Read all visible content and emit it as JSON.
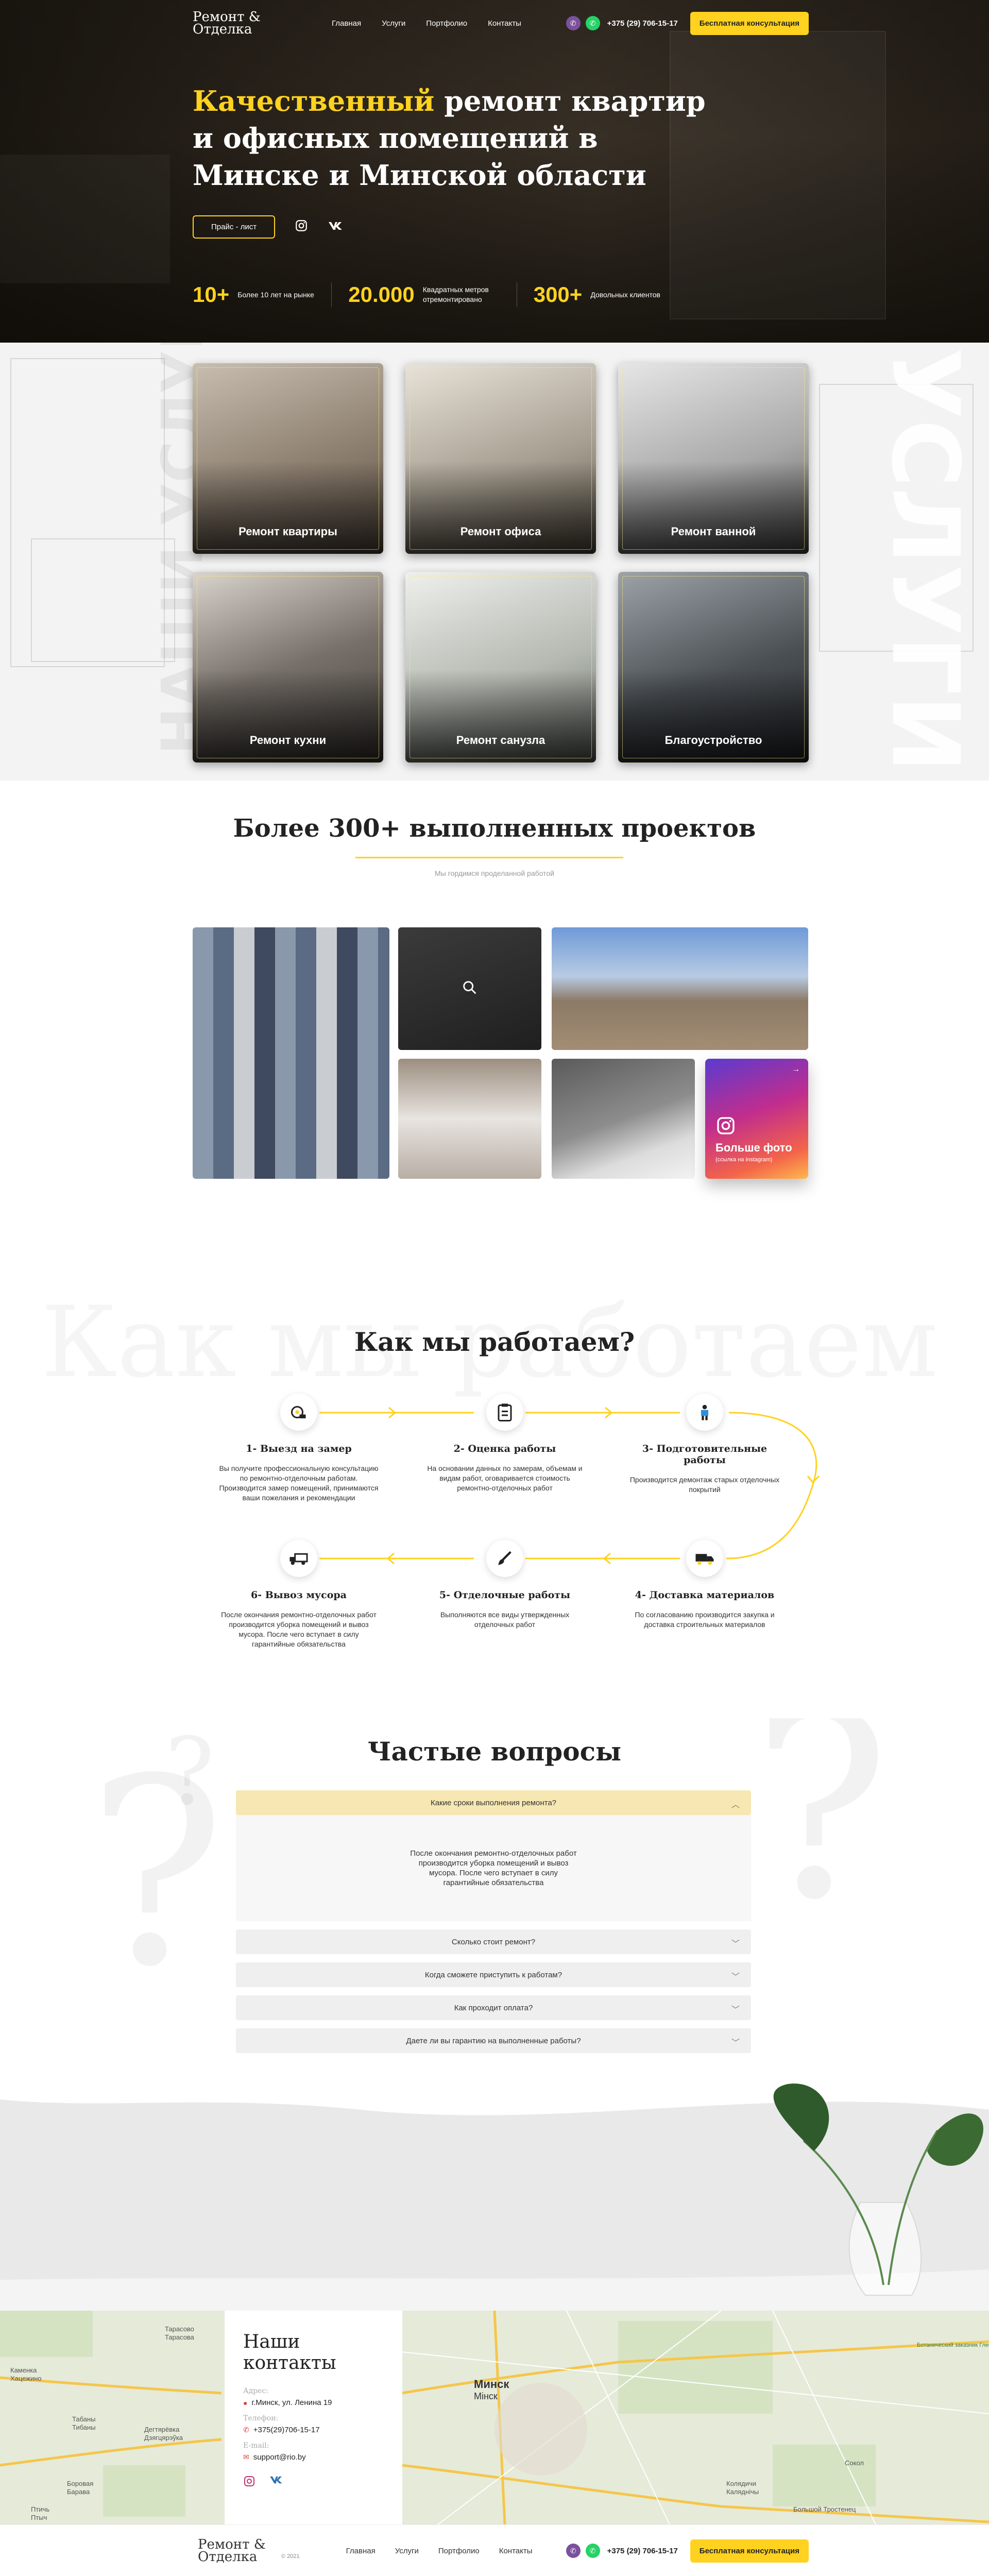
{
  "header": {
    "logo": "Ремонт & Отделка",
    "nav": [
      "Главная",
      "Услуги",
      "Портфолио",
      "Контакты"
    ],
    "phone": "+375 (29) 706-15-17",
    "cta": "Бесплатная консультация"
  },
  "hero": {
    "title_highlight": "Качественный",
    "title_rest": " ремонт квартир и офисных помещений в Минске и Минской области",
    "price_button": "Прайс - лист",
    "stats": [
      {
        "value": "10+",
        "text": "Более 10 лет на рынке"
      },
      {
        "value": "20.000",
        "text": "Квадратных метров отремонтировано"
      },
      {
        "value": "300+",
        "text": "Довольных клиентов"
      }
    ]
  },
  "services": {
    "side_text": "НАШИ УСЛУГИ",
    "side_text_right": "УСЛУГИ",
    "cards": [
      "Ремонт квартиры",
      "Ремонт офиса",
      "Ремонт ванной",
      "Ремонт кухни",
      "Ремонт санузла",
      "Благоустройство"
    ]
  },
  "projects": {
    "title": "Более 300+  выполненных проектов",
    "subtitle": "Мы гордимся проделанной работой",
    "more_photo": "Больше фото",
    "more_photo_sub": "(ссылка на instagram)"
  },
  "how": {
    "bg_text": "Как мы работаем",
    "title": "Как мы работаем?",
    "steps": [
      {
        "title": "1- Выезд на замер",
        "text": "Вы получите профессиональную консультацию по ремонтно-отделочным работам. Производится замер помещений, принимаются ваши пожелания и рекомендации"
      },
      {
        "title": "2- Оценка работы",
        "text": "На основании данных по замерам, объемам и видам работ, оговаривается стоимость ремонтно-отделочных работ"
      },
      {
        "title": "3- Подготовительные работы",
        "text": "Производится демонтаж старых отделочных покрытий"
      },
      {
        "title": "4- Доставка материалов",
        "text": "По согласованию производится закупка и доставка строительных материалов"
      },
      {
        "title": "5- Отделочные работы",
        "text": "Выполняются все виды утвержденных отделочных работ"
      },
      {
        "title": "6- Вывоз мусора",
        "text": "После окончания ремонтно-отделочных работ производится уборка помещений и вывоз мусора. После чего вступает в силу гарантийные обязательства"
      }
    ]
  },
  "faq": {
    "title": "Частые вопросы",
    "items": [
      {
        "q": "Какие сроки выполнения ремонта?",
        "a": "После окончания  ремонтно-отделочных работ производится уборка помещений и вывоз мусора. После чего вступает в силу гарантийные обязательства"
      },
      {
        "q": "Сколько стоит ремонт?"
      },
      {
        "q": "Когда сможете приступить к работам?"
      },
      {
        "q": "Как проходит оплата?"
      },
      {
        "q": "Даете ли вы гарантию на выполненные работы?"
      }
    ]
  },
  "contacts": {
    "title": "Наши контакты",
    "address_label": "Адрес:",
    "address": "г.Минск, ул. Ленина 19",
    "phone_label": "Телефон:",
    "phone": "+375(29)706-15-17",
    "email_label": "E-mail:",
    "email": "support@rio.by",
    "map_labels": [
      "Тарасово",
      "Тарасова",
      "Каменка",
      "Хацежино",
      "Табаны",
      "Тибаны",
      "Дегтярёвка",
      "Дзягцярэўка",
      "Боровая",
      "Барава",
      "Минск",
      "Мінск",
      "Ботанический заказник Глебовка",
      "Сокол",
      "Колядичи",
      "Каляднічы",
      "Большой Тростенец",
      "Птичь",
      "Птыч"
    ]
  },
  "footer": {
    "logo": "Ремонт & Отделка",
    "copyright": "© 2021",
    "nav": [
      "Главная",
      "Услуги",
      "Портфолио",
      "Контакты"
    ],
    "phone": "+375 (29) 706-15-17",
    "cta": "Бесплатная консультация"
  },
  "colors": {
    "accent": "#ffd21f",
    "viber": "#7b519d",
    "whatsapp": "#25d366",
    "dark": "#1c1711"
  }
}
